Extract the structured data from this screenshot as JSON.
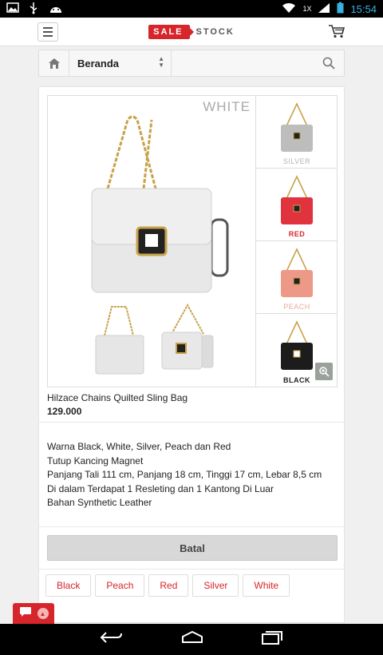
{
  "status_bar": {
    "time": "15:54",
    "network": "1X"
  },
  "app_bar": {
    "logo_sale": "SALE",
    "logo_stock": "STOCK"
  },
  "nav": {
    "category": "Beranda"
  },
  "product": {
    "main_color_label": "WHITE",
    "thumbnails": [
      {
        "label": "SILVER",
        "color": "#bdbdbd",
        "label_color": "#b5b5b5"
      },
      {
        "label": "RED",
        "color": "#e0333d",
        "label_color": "#d6262b"
      },
      {
        "label": "PEACH",
        "color": "#ee9988",
        "label_color": "#e8a99b"
      },
      {
        "label": "BLACK",
        "color": "#1c1c1c",
        "label_color": "#222222"
      }
    ],
    "title": "Hilzace Chains Quilted Sling Bag",
    "price": "129.000",
    "description": [
      "Warna Black, White, Silver, Peach dan Red",
      "Tutup Kancing Magnet",
      "Panjang Tali 111 cm, Panjang 18 cm, Tinggi 17 cm, Lebar 8,5 cm",
      "Di dalam Terdapat 1 Resleting dan 1 Kantong Di Luar",
      "Bahan Synthetic Leather"
    ],
    "cancel_label": "Batal",
    "variants": [
      "Black",
      "Peach",
      "Red",
      "Silver",
      "White"
    ]
  },
  "colors": {
    "brand_red": "#d6262b",
    "bag_white": "#ececec"
  }
}
